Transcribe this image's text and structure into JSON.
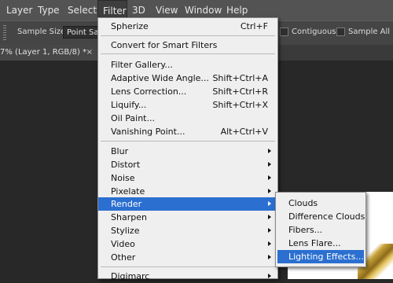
{
  "menubar": {
    "items": [
      "Layer",
      "Type",
      "Select",
      "Filter",
      "3D",
      "View",
      "Window",
      "Help"
    ]
  },
  "options": {
    "sample_size_label": "Sample Size:",
    "sample_size_value": "Point Sam",
    "contiguous_label": "Contiguous",
    "sample_all_label": "Sample All Laye"
  },
  "document_tab": {
    "title": "7% (Layer 1, RGB/8) *",
    "close": "×"
  },
  "filter_menu": {
    "group1": [
      {
        "label": "Spherize",
        "shortcut": "Ctrl+F"
      }
    ],
    "group2": [
      {
        "label": "Convert for Smart Filters",
        "shortcut": ""
      }
    ],
    "group3": [
      {
        "label": "Filter Gallery...",
        "shortcut": ""
      },
      {
        "label": "Adaptive Wide Angle...",
        "shortcut": "Shift+Ctrl+A"
      },
      {
        "label": "Lens Correction...",
        "shortcut": "Shift+Ctrl+R"
      },
      {
        "label": "Liquify...",
        "shortcut": "Shift+Ctrl+X"
      },
      {
        "label": "Oil Paint...",
        "shortcut": ""
      },
      {
        "label": "Vanishing Point...",
        "shortcut": "Alt+Ctrl+V"
      }
    ],
    "group4": [
      {
        "label": "Blur"
      },
      {
        "label": "Distort"
      },
      {
        "label": "Noise"
      },
      {
        "label": "Pixelate"
      },
      {
        "label": "Render"
      },
      {
        "label": "Sharpen"
      },
      {
        "label": "Stylize"
      },
      {
        "label": "Video"
      },
      {
        "label": "Other"
      }
    ],
    "group5": [
      {
        "label": "Digimarc"
      }
    ]
  },
  "render_submenu": {
    "items": [
      "Clouds",
      "Difference Clouds",
      "Fibers...",
      "Lens Flare...",
      "Lighting Effects..."
    ],
    "highlighted": "Lighting Effects..."
  },
  "colors": {
    "highlight": "#2b6fd0",
    "menu_bg": "#efefef",
    "menubar_bg": "#535353"
  }
}
